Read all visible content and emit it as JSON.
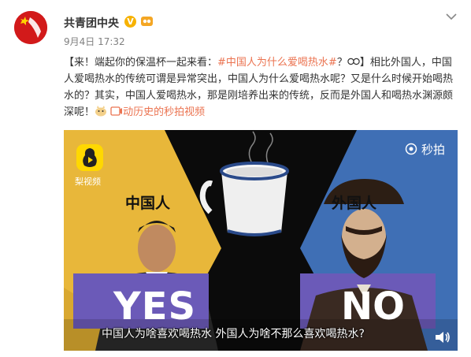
{
  "post": {
    "author": "共青团中央",
    "verified_icon": "vip-v-icon",
    "time": "9月4日 17:32",
    "text_prefix": "【来！端起你的保温杯一起来看：",
    "hashtag": "#中国人为什么爱喝热水#",
    "text_after_tag": "？",
    "text_body": "】相比外国人，中国人爱喝热水的传统可谓是异常突出，中国人为什么爱喝热水呢？又是什么时候开始喝热水的？其实，中国人爱喝热水，那是刚培养出来的传统，反而是外国人和喝热水渊源颇深呢！",
    "link_text": "动历史的秒拍视频"
  },
  "video": {
    "pear_label": "梨视频",
    "miaopai_label": "秒拍",
    "label_chinese": "中国人",
    "label_foreign": "外国人",
    "yes_text": "YES",
    "no_text": "NO",
    "subtitle": "中国人为啥喜欢喝热水 外国人为啥不那么喜欢喝热水?"
  },
  "colors": {
    "accent": "#eb7350",
    "left_panel": "#e8b73a",
    "right_panel": "#3f6fb5",
    "center_panel": "#0b0b0b",
    "box_purple": "#6b5ab8"
  }
}
